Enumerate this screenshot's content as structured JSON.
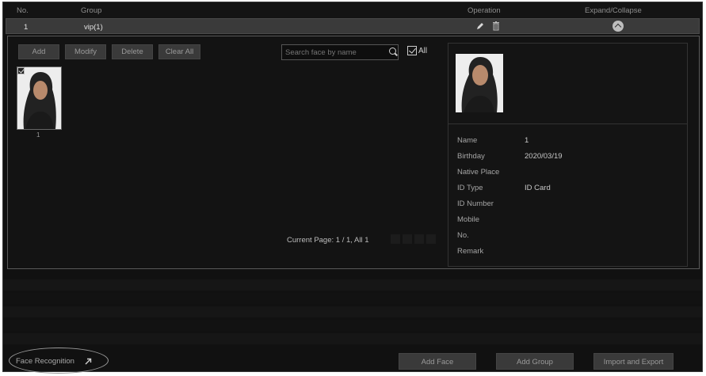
{
  "table": {
    "headers": {
      "no": "No.",
      "group": "Group",
      "operation": "Operation",
      "expand": "Expand/Collapse"
    },
    "row": {
      "no": "1",
      "group": "vip(1)"
    }
  },
  "toolbar": {
    "add": "Add",
    "modify": "Modify",
    "delete": "Delete",
    "clear_all": "Clear All"
  },
  "search": {
    "placeholder": "Search face by name",
    "all_label": "All"
  },
  "faces": [
    {
      "label": "1",
      "checked": true
    }
  ],
  "pager": {
    "text": "Current Page: 1 / 1, All 1"
  },
  "detail": {
    "fields": [
      {
        "label": "Name",
        "value": "1"
      },
      {
        "label": "Birthday",
        "value": "2020/03/19"
      },
      {
        "label": "Native Place",
        "value": ""
      },
      {
        "label": "ID Type",
        "value": "ID Card"
      },
      {
        "label": "ID Number",
        "value": ""
      },
      {
        "label": "Mobile",
        "value": ""
      },
      {
        "label": "No.",
        "value": ""
      },
      {
        "label": "Remark",
        "value": ""
      }
    ]
  },
  "footer": {
    "face_recognition": "Face Recognition",
    "add_face": "Add Face",
    "add_group": "Add Group",
    "import_export": "Import and Export"
  },
  "icons": {
    "edit": "pencil-icon",
    "delete": "trash-icon",
    "collapse": "collapse-circle-icon",
    "search": "search-icon",
    "link": "external-arrow-icon"
  }
}
